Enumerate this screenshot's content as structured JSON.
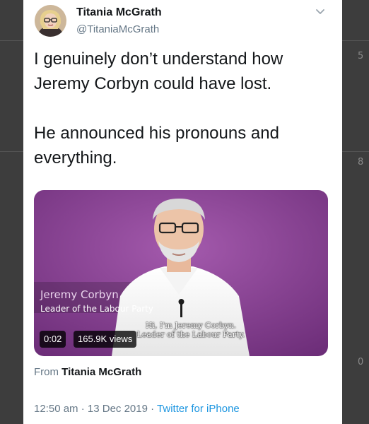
{
  "tweet": {
    "author_name": "Titania McGrath",
    "author_handle": "@TitaniaMcGrath",
    "text_paragraphs": [
      "I genuinely don’t understand how Jeremy Corbyn could have lost.",
      "He announced his pronouns and everything."
    ]
  },
  "video": {
    "lower_third_name": "Jeremy Corbyn",
    "lower_third_role": "Leader of the Labour Party",
    "caption_line1": "Hi, I'm Jeremy Corbyn.",
    "caption_line2": "Leader of the Labour Party.",
    "duration": "0:02",
    "views": "165.9K views"
  },
  "source": {
    "prefix": "From",
    "name": "Titania McGrath"
  },
  "meta": {
    "time": "12:50 am",
    "date": "13 Dec 2019",
    "separator": "·",
    "client": "Twitter for iPhone"
  },
  "background": {
    "right_digits": [
      "5",
      "8",
      "0"
    ]
  },
  "colors": {
    "link": "#1b95e0",
    "secondary_text": "#657786",
    "primary_text": "#14171a",
    "video_backdrop": "#8a3f93"
  }
}
